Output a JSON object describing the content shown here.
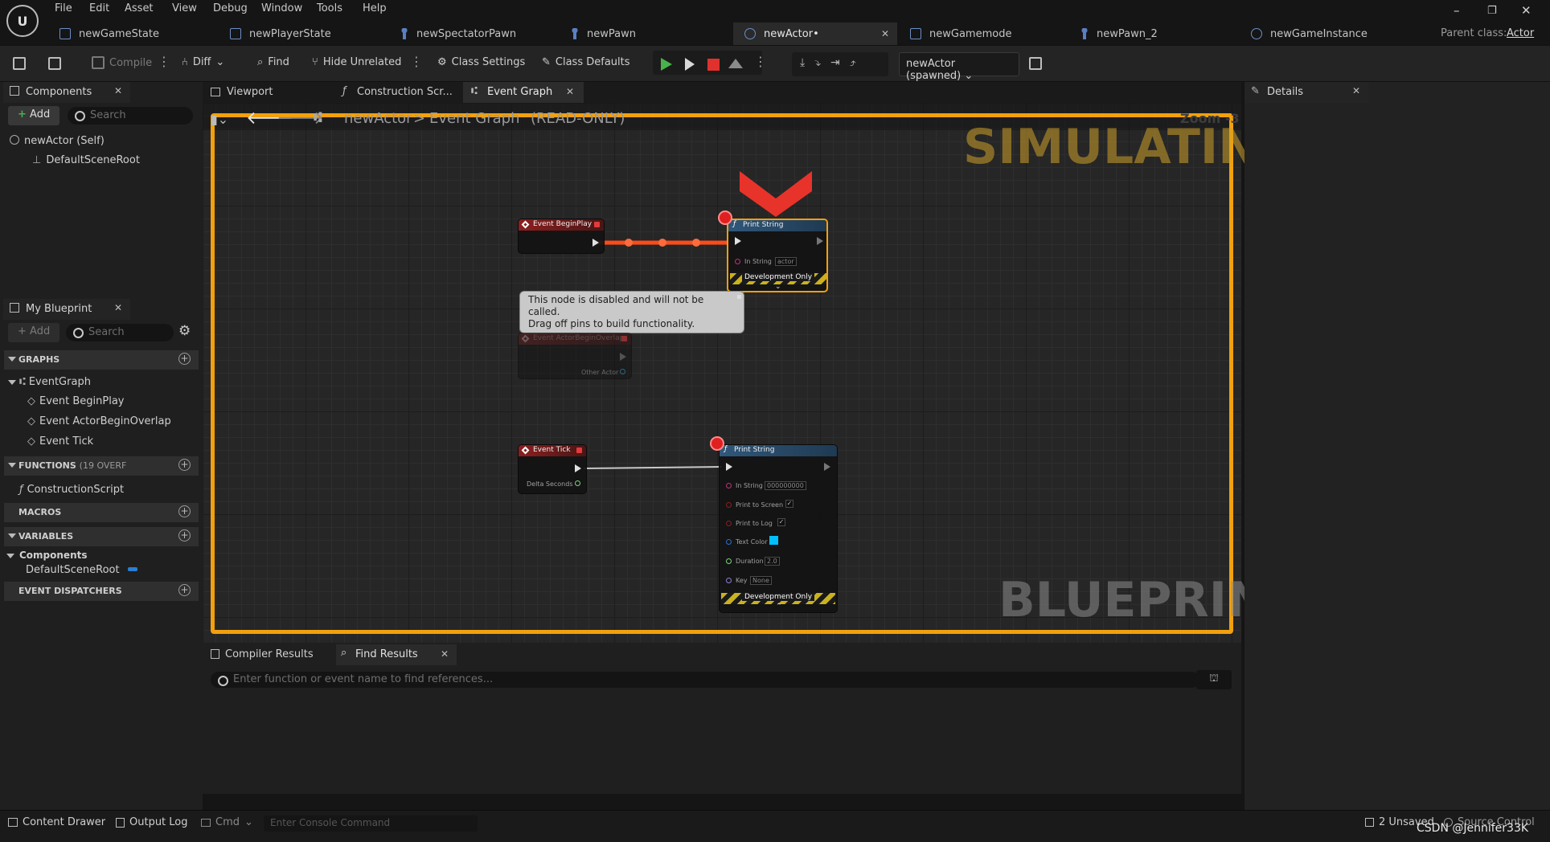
{
  "menu": [
    "File",
    "Edit",
    "Asset",
    "View",
    "Debug",
    "Window",
    "Tools",
    "Help"
  ],
  "doc_tabs": [
    "newGameState",
    "newPlayerState",
    "newSpectatorPawn",
    "newPawn",
    "newActor•",
    "newGamemode",
    "newPawn_2",
    "newGameInstance"
  ],
  "parent_class": {
    "label": "Parent class:",
    "value": "Actor"
  },
  "toolbar": {
    "compile": "Compile",
    "diff": "Diff",
    "find": "Find",
    "hide_unrelated": "Hide Unrelated",
    "class_settings": "Class Settings",
    "class_defaults": "Class Defaults",
    "debug_object": "newActor (spawned)"
  },
  "components_panel": {
    "title": "Components",
    "add": "Add",
    "search_placeholder": "Search",
    "items": [
      "newActor (Self)",
      "DefaultSceneRoot"
    ]
  },
  "my_blueprint": {
    "title": "My Blueprint",
    "add": "Add",
    "search_placeholder": "Search",
    "sections": {
      "graphs": "GRAPHS",
      "functions": "FUNCTIONS",
      "functions_note": "(19 OVERF",
      "macros": "MACROS",
      "variables": "VARIABLES",
      "event_dispatchers": "EVENT DISPATCHERS"
    },
    "graph_name": "EventGraph",
    "events": [
      "Event BeginPlay",
      "Event ActorBeginOverlap",
      "Event Tick"
    ],
    "functions": [
      "ConstructionScript"
    ],
    "var_category": "Components",
    "variables": [
      "DefaultSceneRoot"
    ]
  },
  "graph_tabs": [
    "Viewport",
    "Construction Scr...",
    "Event Graph"
  ],
  "breadcrumb": {
    "actor": "newActor",
    "sep": ">",
    "graph": "Event Graph",
    "mode": "(READ-ONLY)",
    "zoom": "Zoom -3"
  },
  "watermarks": {
    "simulating": "SIMULATING",
    "blueprint": "BLUEPRINT"
  },
  "nodes": {
    "begin_play": "Event BeginPlay",
    "print1": {
      "title": "Print String",
      "in_string_label": "In String",
      "in_string": "actor",
      "dev": "Development Only"
    },
    "overlap": {
      "title": "Event ActorBeginOverlap",
      "pin": "Other Actor"
    },
    "tooltip": [
      "This node is disabled and will not be called.",
      "Drag off pins to build functionality."
    ],
    "tick": {
      "title": "Event Tick",
      "pin": "Delta Seconds"
    },
    "print2": {
      "title": "Print String",
      "in_string_label": "In String",
      "in_string": "000000000",
      "print_screen": "Print to Screen",
      "print_log": "Print to Log",
      "text_color": "Text Color",
      "duration_label": "Duration",
      "duration": "2.0",
      "key_label": "Key",
      "key": "None",
      "dev": "Development Only"
    }
  },
  "bottom_tabs": [
    "Compiler Results",
    "Find Results"
  ],
  "find_placeholder": "Enter function or event name to find references...",
  "details_title": "Details",
  "status": {
    "content_drawer": "Content Drawer",
    "output_log": "Output Log",
    "cmd": "Cmd",
    "console_placeholder": "Enter Console Command",
    "unsaved": "2 Unsaved",
    "source_control": "Source Control",
    "credit": "CSDN @Jennifer33K"
  },
  "colors": {
    "accent_orange": "#f2a00d",
    "breakpoint": "#e02020",
    "text_color_swatch": "#00bfff"
  }
}
